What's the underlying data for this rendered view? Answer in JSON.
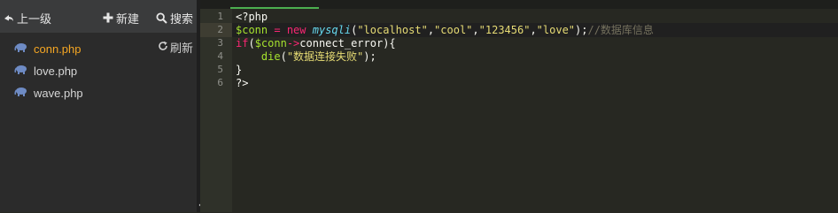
{
  "colors": {
    "sidebar_bg": "#2b2b2b",
    "toolbar_bg": "#3a3b3c",
    "editor_bg": "#272822",
    "active_file": "#f5a623",
    "tab_accent": "#4caf50"
  },
  "toolbar": {
    "up_label": "上一级",
    "new_label": "新建",
    "search_label": "搜索"
  },
  "sidebar": {
    "refresh_label": "刷新",
    "files": [
      {
        "name": "conn.php",
        "icon": "elephant-php-icon",
        "active": true
      },
      {
        "name": "love.php",
        "icon": "elephant-php-icon",
        "active": false
      },
      {
        "name": "wave.php",
        "icon": "elephant-php-icon",
        "active": false
      }
    ]
  },
  "editor": {
    "line_numbers": [
      "1",
      "2",
      "3",
      "4",
      "5",
      "6"
    ],
    "lines": [
      [
        {
          "t": "<?php",
          "c": "#f8f8f2"
        }
      ],
      [
        {
          "t": "$conn",
          "c": "#a6e22e"
        },
        {
          "t": " = ",
          "c": "#f92672"
        },
        {
          "t": "new",
          "c": "#f92672"
        },
        {
          "t": " ",
          "c": "#f8f8f2"
        },
        {
          "t": "mysqli",
          "c": "#66d9ef",
          "i": true
        },
        {
          "t": "(",
          "c": "#f8f8f2"
        },
        {
          "t": "\"localhost\"",
          "c": "#e6db74"
        },
        {
          "t": ",",
          "c": "#f8f8f2"
        },
        {
          "t": "\"cool\"",
          "c": "#e6db74"
        },
        {
          "t": ",",
          "c": "#f8f8f2"
        },
        {
          "t": "\"123456\"",
          "c": "#e6db74"
        },
        {
          "t": ",",
          "c": "#f8f8f2"
        },
        {
          "t": "\"love\"",
          "c": "#e6db74"
        },
        {
          "t": ");",
          "c": "#f8f8f2"
        },
        {
          "t": "//数据库信息",
          "c": "#75715e"
        }
      ],
      [
        {
          "t": "if",
          "c": "#f92672"
        },
        {
          "t": "(",
          "c": "#f8f8f2"
        },
        {
          "t": "$conn",
          "c": "#a6e22e"
        },
        {
          "t": "->",
          "c": "#f92672"
        },
        {
          "t": "connect_error",
          "c": "#f8f8f2"
        },
        {
          "t": "){",
          "c": "#f8f8f2"
        }
      ],
      [
        {
          "t": "    ",
          "c": "#f8f8f2"
        },
        {
          "t": "die",
          "c": "#a6e22e"
        },
        {
          "t": "(",
          "c": "#f8f8f2"
        },
        {
          "t": "\"数据连接失败\"",
          "c": "#e6db74"
        },
        {
          "t": ");",
          "c": "#f8f8f2"
        }
      ],
      [
        {
          "t": "}",
          "c": "#f8f8f2"
        }
      ],
      [
        {
          "t": "?>",
          "c": "#f8f8f2"
        }
      ]
    ]
  }
}
